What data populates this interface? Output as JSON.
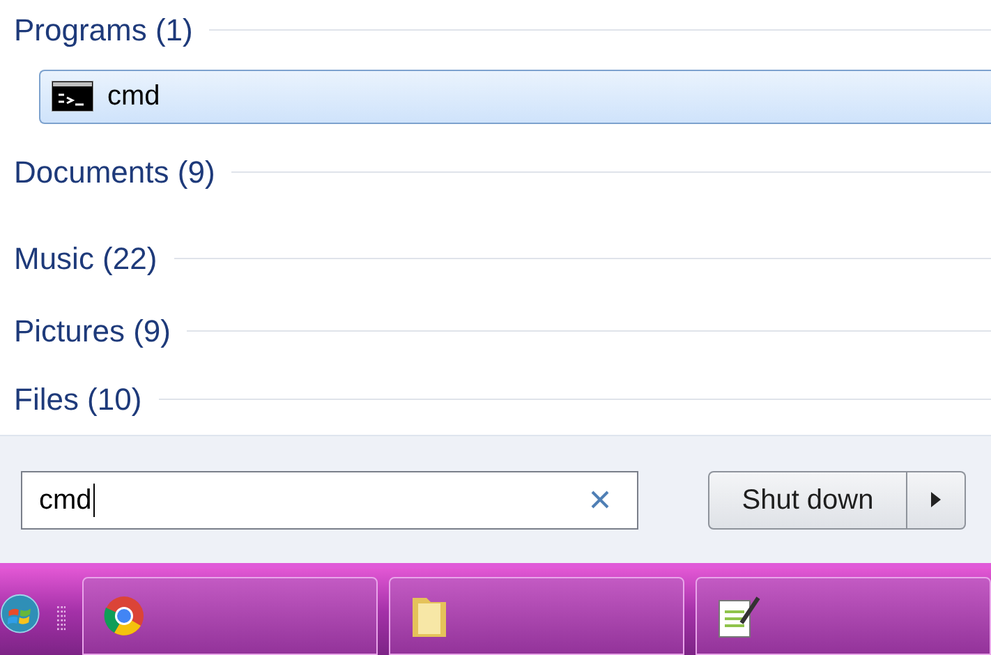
{
  "results": [
    {
      "title": "Programs (1)",
      "items": [
        {
          "label": "cmd",
          "selected": true
        }
      ]
    },
    {
      "title": "Documents (9)"
    },
    {
      "title": "Music (22)"
    },
    {
      "title": "Pictures (9)"
    },
    {
      "title": "Files (10)"
    }
  ],
  "search": {
    "value": "cmd"
  },
  "shutdown": {
    "label": "Shut down"
  },
  "taskbar": {
    "buttons": [
      {
        "kind": "browser"
      },
      {
        "kind": "folder"
      },
      {
        "kind": "notepad"
      }
    ]
  }
}
